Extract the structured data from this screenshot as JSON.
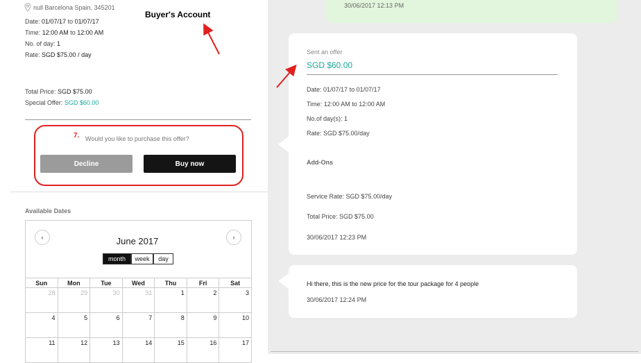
{
  "listing": {
    "location": "null Barcelona Spain, 345201",
    "date_label": "Date:",
    "date_from": "01/07/17",
    "date_to_word": "to",
    "date_to": "01/07/17",
    "time_label": "Time:",
    "time_from": "12:00 AM",
    "time_to": "12:00 AM",
    "days_label": "No. of day:",
    "days_value": "1",
    "rate_label": "Rate:",
    "rate_value": "SGD $75.00 / day",
    "total_label": "Total Price:",
    "total_value": "SGD $75.00",
    "special_label": "Special Offer:",
    "special_value": "SGD $60.00"
  },
  "annotations": {
    "account": "Buyer's Account",
    "step": "7."
  },
  "purchase": {
    "question": "Would you like to purchase this offer?",
    "decline": "Decline",
    "buy": "Buy now"
  },
  "calendar": {
    "section_label": "Available Dates",
    "title": "June 2017",
    "prev": "‹",
    "next": "›",
    "views": [
      "month",
      "week",
      "day"
    ],
    "weekdays": [
      "Sun",
      "Mon",
      "Tue",
      "Wed",
      "Thu",
      "Fri",
      "Sat"
    ],
    "weeks": [
      [
        {
          "d": "28",
          "other": true
        },
        {
          "d": "29",
          "other": true
        },
        {
          "d": "30",
          "other": true
        },
        {
          "d": "31",
          "other": true
        },
        {
          "d": "1"
        },
        {
          "d": "2"
        },
        {
          "d": "3"
        }
      ],
      [
        {
          "d": "4"
        },
        {
          "d": "5"
        },
        {
          "d": "6"
        },
        {
          "d": "7"
        },
        {
          "d": "8"
        },
        {
          "d": "9"
        },
        {
          "d": "10"
        }
      ],
      [
        {
          "d": "11"
        },
        {
          "d": "12"
        },
        {
          "d": "13"
        },
        {
          "d": "14"
        },
        {
          "d": "15"
        },
        {
          "d": "16"
        },
        {
          "d": "17"
        }
      ]
    ]
  },
  "chat": {
    "top_timestamp": "30/06/2017 12:13 PM",
    "offer": {
      "heading": "Sent an offer",
      "price": "SGD $60.00",
      "date_label": "Date:",
      "date_value": "01/07/17 to 01/07/17",
      "time_label": "Time:",
      "time_value": "12:00 AM to 12:00 AM",
      "days_label": "No.of day(s):",
      "days_value": "1",
      "rate_label": "Rate:",
      "rate_value": "SGD $75.00/day",
      "addons_label": "Add-Ons",
      "service_label": "Service Rate:",
      "service_value": "SGD $75.00/day",
      "total_label": "Total Price:",
      "total_value": "SGD $75.00",
      "timestamp": "30/06/2017 12:23 PM"
    },
    "message": {
      "text": "Hi there, this is the new price for the tour package for 4 people",
      "timestamp": "30/06/2017 12:24 PM"
    }
  },
  "colors": {
    "teal": "#1aa89a",
    "annotation_red": "#e02020",
    "chat_green": "#e2f5dd"
  }
}
